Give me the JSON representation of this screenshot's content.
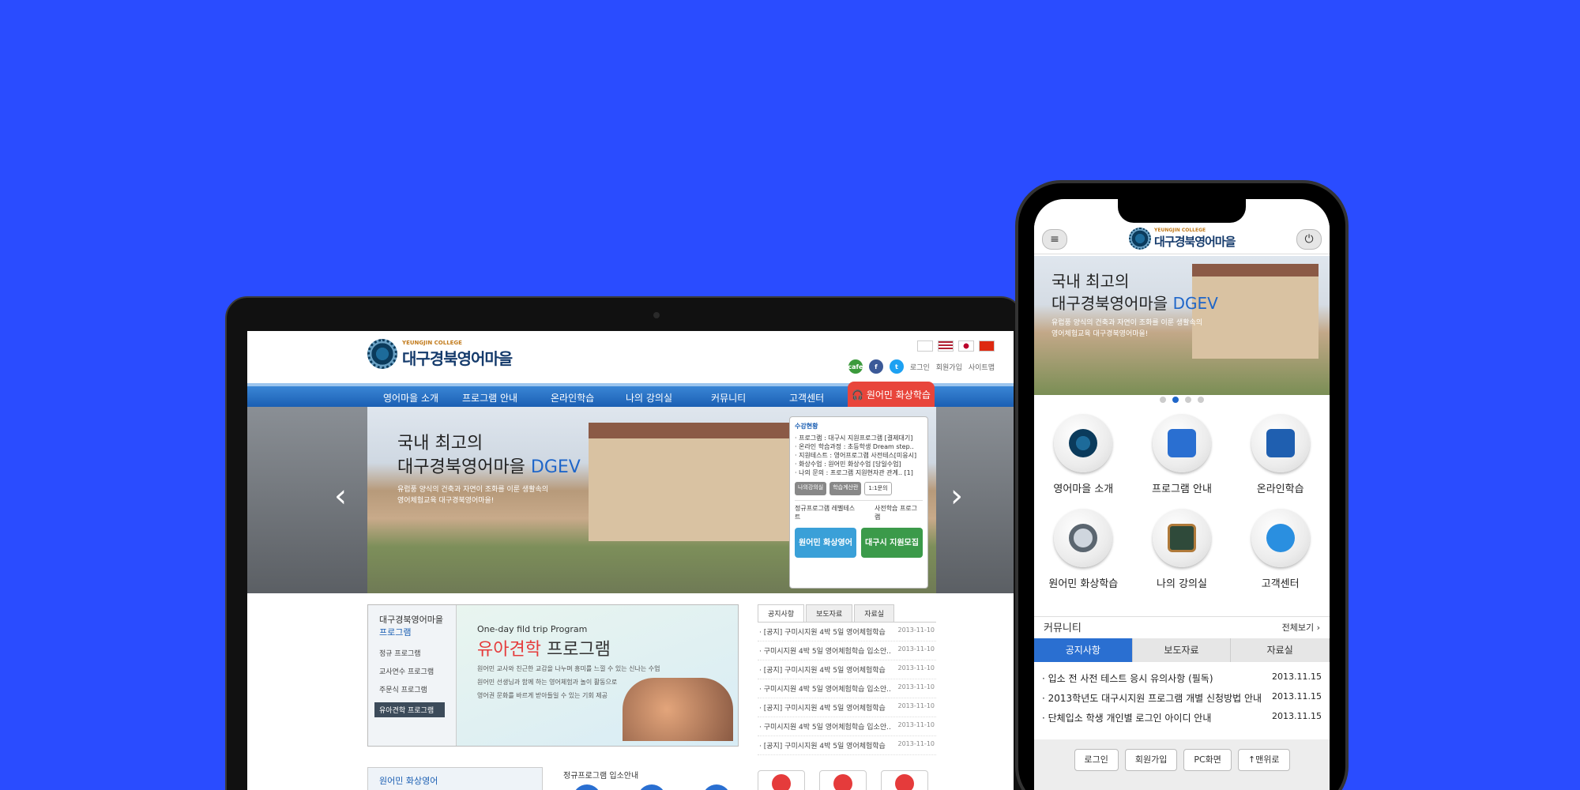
{
  "desktop": {
    "logo": {
      "sub": "YEUNGJIN COLLEGE",
      "title": "대구경북영어마을"
    },
    "util": {
      "login": "로그인",
      "join": "회원가입",
      "sitemap": "사이트맵",
      "cafe": "cafe"
    },
    "gnb": [
      "영어마을 소개",
      "프로그램 안내",
      "온라인학습",
      "나의 강의실",
      "커뮤니티",
      "고객센터"
    ],
    "gnb_special": "원어민 화상학습",
    "hero": {
      "line1": "국내 최고의",
      "line2": "대구경북영어마을",
      "accent": "DGEV",
      "desc1": "유럽풍 양식의 건축과 자연이 조화를 이룬 생활속의",
      "desc2": "영어체험교육 대구경북영어마을!"
    },
    "status_box": {
      "title": "수강현황",
      "rows": [
        "· 프로그램 : 대구시 지원프로그램 [결제대기]",
        "· 온라인 학습과정 : 초등학생 Dream step..",
        "· 지원테스트 : 영어프로그램 사전테스[미응시]",
        "· 화상수업 : 원어민 화상수업 [당일수업]",
        "· 나의 문의 : 프로그램 지원현자관 관계.. [1]"
      ],
      "buttons": [
        "나의강의실",
        "학습계산란",
        "1:1문의"
      ],
      "sub1": "정규프로그램 레벨테스트",
      "sub2": "사전학습 프로그램",
      "banner1": "원어민 화상영어",
      "banner2": "대구시 지원모집"
    },
    "program": {
      "side_title": "대구경북영어마을",
      "side_title2": "프로그램",
      "items": [
        "정규 프로그램",
        "교사연수 프로그램",
        "주문식 프로그램",
        "유아견학 프로그램"
      ],
      "en": "One-day fild trip Program",
      "kr_red": "유아견학",
      "kr_rest": " 프로그램",
      "bullets": [
        "원어민 교사와 친근한 교감을 나누며 흥미를 느낄 수 있는 신나는 수업",
        "원어민 선생님과 함께 하는 영어체험과 놀이 활동으로",
        "영어권 문화를 바르게 받아들일 수 있는 기회 제공"
      ]
    },
    "news": {
      "tabs": [
        "공지사항",
        "보도자료",
        "자료실"
      ],
      "rows": [
        {
          "t": "· [공지] 구미시지원 4박 5일 영어체험학습",
          "d": "2013-11-10"
        },
        {
          "t": "· 구미시지원 4박 5일 영어체험학습 입소안..",
          "d": "2013-11-10"
        },
        {
          "t": "· [공지] 구미시지원 4박 5일 영어체험학습",
          "d": "2013-11-10"
        },
        {
          "t": "· 구미시지원 4박 5일 영어체험학습 입소안..",
          "d": "2013-11-10"
        },
        {
          "t": "· [공지] 구미시지원 4박 5일 영어체험학습",
          "d": "2013-11-10"
        },
        {
          "t": "· 구미시지원 4박 5일 영어체험학습 입소안..",
          "d": "2013-11-10"
        },
        {
          "t": "· [공지] 구미시지원 4박 5일 영어체험학습",
          "d": "2013-11-10"
        }
      ]
    },
    "bottom": {
      "video_title": "원어민 화상영어",
      "guide": "정규프로그램 입소안내"
    }
  },
  "mobile": {
    "logo": {
      "sub": "YEUNGJIN COLLEGE",
      "title": "대구경북영어마을"
    },
    "hero": {
      "line1": "국내 최고의",
      "line2": "대구경북영어마을",
      "accent": "DGEV",
      "desc1": "유럽풍 양식의 건축과 자연이 조화를 이룬 생활속의",
      "desc2": "영어체험교육 대구경북영어마을!"
    },
    "menu": [
      {
        "label": "영어마을 소개",
        "icon": "emblem-icon"
      },
      {
        "label": "프로그램 안내",
        "icon": "clipboard-icon"
      },
      {
        "label": "온라인학습",
        "icon": "book-icon"
      },
      {
        "label": "원어민 화상학습",
        "icon": "webcam-icon"
      },
      {
        "label": "나의 강의실",
        "icon": "blackboard-icon"
      },
      {
        "label": "고객센터",
        "icon": "chat-icon"
      }
    ],
    "community": {
      "title": "커뮤니티",
      "all": "전체보기"
    },
    "tabs": [
      "공지사항",
      "보도자료",
      "자료실"
    ],
    "list": [
      {
        "t": "· 입소 전 사전 테스트 응시 유의사항 (필독)",
        "d": "2013.11.15"
      },
      {
        "t": "· 2013학년도 대구시지원 프로그램 개별 신청방법 안내",
        "d": "2013.11.15"
      },
      {
        "t": "· 단체입소 학생 개인별 로그인 아이디 안내",
        "d": "2013.11.15"
      }
    ],
    "footer": [
      "로그인",
      "회원가입",
      "PC화면",
      "↑맨위로"
    ]
  }
}
